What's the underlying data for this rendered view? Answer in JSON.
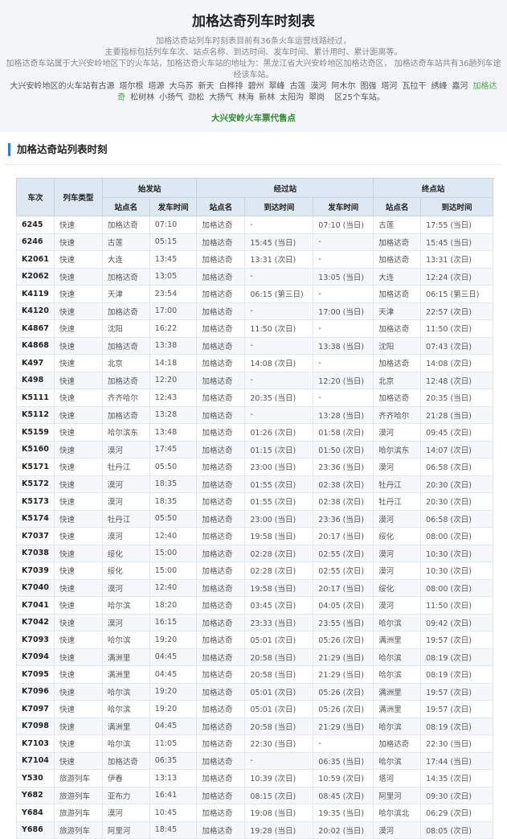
{
  "page": {
    "title": "加格达奇列车时刻表",
    "intro": [
      "加格达奇站列车时刻表目前有36条火车运营线路经过，",
      "主要指标包括列车车次、站点名称、到达时间、发车时间、累计用时、累计距离等。",
      "加格达奇车站属于大兴安岭地区下的火车站，加格达奇火车站的地址为：黑龙江省大兴安岭地区加格达奇区， 加格达奇车站共有36趟列车途经该车站。",
      "大兴安岭地区的火车站有"
    ],
    "cities": [
      "古源",
      "塔尔根",
      "塔源",
      "大乌苏",
      "新天",
      "白桦排",
      "碧州",
      "翠峰",
      "古莲",
      "漠河",
      "阿木尔",
      "图强",
      "塔河",
      "瓦拉干",
      "绣峰",
      "嘉河",
      "加格达奇",
      "松树林",
      "小扬气",
      "劲松",
      "大扬气",
      "林海",
      "新林",
      "太阳沟",
      "翠岗"
    ],
    "highlight_city": "加格达奇",
    "cities_suffix": "区25个车站。",
    "ticket_link": "大兴安岭火车票代售点",
    "section_title": "加格达奇站列表时刻"
  },
  "table": {
    "header_top": [
      "车次",
      "列车类型",
      "始发站",
      "经过站",
      "终点站"
    ],
    "header_sub": [
      "站点名",
      "发车时间",
      "站点名",
      "到达时间",
      "发车时间",
      "站点名",
      "到达时间"
    ],
    "rows": [
      [
        "6245",
        "快速",
        "加格达奇",
        "07:10",
        "加格达奇",
        "-",
        "07:10 (当日)",
        "古莲",
        "17:55 (当日)"
      ],
      [
        "6246",
        "快速",
        "古莲",
        "05:15",
        "加格达奇",
        "15:45 (当日)",
        "-",
        "加格达奇",
        "15:45 (当日)"
      ],
      [
        "K2061",
        "快速",
        "大连",
        "13:45",
        "加格达奇",
        "13:31 (次日)",
        "-",
        "加格达奇",
        "13:31 (次日)"
      ],
      [
        "K2062",
        "快速",
        "加格达奇",
        "13:05",
        "加格达奇",
        "-",
        "13:05 (当日)",
        "大连",
        "12:24 (次日)"
      ],
      [
        "K4119",
        "快速",
        "天津",
        "23:54",
        "加格达奇",
        "06:15 (第三日)",
        "-",
        "加格达奇",
        "06:15 (第三日)"
      ],
      [
        "K4120",
        "快速",
        "加格达奇",
        "17:00",
        "加格达奇",
        "-",
        "17:00 (当日)",
        "天津",
        "22:57 (次日)"
      ],
      [
        "K4867",
        "快速",
        "沈阳",
        "16:22",
        "加格达奇",
        "11:50 (次日)",
        "-",
        "加格达奇",
        "11:50 (次日)"
      ],
      [
        "K4868",
        "快速",
        "加格达奇",
        "13:38",
        "加格达奇",
        "-",
        "13:38 (当日)",
        "沈阳",
        "07:43 (次日)"
      ],
      [
        "K497",
        "快速",
        "北京",
        "14:18",
        "加格达奇",
        "14:08 (次日)",
        "-",
        "加格达奇",
        "14:08 (次日)"
      ],
      [
        "K498",
        "快速",
        "加格达奇",
        "12:20",
        "加格达奇",
        "-",
        "12:20 (当日)",
        "北京",
        "12:48 (次日)"
      ],
      [
        "K5111",
        "快速",
        "齐齐哈尔",
        "12:43",
        "加格达奇",
        "20:35 (当日)",
        "-",
        "加格达奇",
        "20:35 (当日)"
      ],
      [
        "K5112",
        "快速",
        "加格达奇",
        "13:28",
        "加格达奇",
        "-",
        "13:28 (当日)",
        "齐齐哈尔",
        "21:28 (当日)"
      ],
      [
        "K5159",
        "快速",
        "哈尔滨东",
        "13:48",
        "加格达奇",
        "01:26 (次日)",
        "01:58 (次日)",
        "漠河",
        "09:45 (次日)"
      ],
      [
        "K5160",
        "快速",
        "漠河",
        "17:45",
        "加格达奇",
        "01:15 (次日)",
        "01:50 (次日)",
        "哈尔滨东",
        "14:07 (次日)"
      ],
      [
        "K5171",
        "快速",
        "牡丹江",
        "05:50",
        "加格达奇",
        "23:00 (当日)",
        "23:36 (当日)",
        "漠河",
        "06:58 (次日)"
      ],
      [
        "K5172",
        "快速",
        "漠河",
        "18:35",
        "加格达奇",
        "01:55 (次日)",
        "02:38 (次日)",
        "牡丹江",
        "20:30 (次日)"
      ],
      [
        "K5173",
        "快速",
        "漠河",
        "18:35",
        "加格达奇",
        "01:55 (次日)",
        "02:38 (次日)",
        "牡丹江",
        "20:30 (次日)"
      ],
      [
        "K5174",
        "快速",
        "牡丹江",
        "05:50",
        "加格达奇",
        "23:00 (当日)",
        "23:36 (当日)",
        "漠河",
        "06:58 (次日)"
      ],
      [
        "K7037",
        "快速",
        "漠河",
        "12:40",
        "加格达奇",
        "19:58 (当日)",
        "20:17 (当日)",
        "绥化",
        "08:00 (次日)"
      ],
      [
        "K7038",
        "快速",
        "绥化",
        "15:00",
        "加格达奇",
        "02:28 (次日)",
        "02:55 (次日)",
        "漠河",
        "10:30 (次日)"
      ],
      [
        "K7039",
        "快速",
        "绥化",
        "15:00",
        "加格达奇",
        "02:28 (次日)",
        "02:55 (次日)",
        "漠河",
        "10:30 (次日)"
      ],
      [
        "K7040",
        "快速",
        "漠河",
        "12:40",
        "加格达奇",
        "19:58 (当日)",
        "20:17 (当日)",
        "绥化",
        "08:00 (次日)"
      ],
      [
        "K7041",
        "快速",
        "哈尔滨",
        "18:20",
        "加格达奇",
        "03:45 (次日)",
        "04:05 (次日)",
        "漠河",
        "11:50 (次日)"
      ],
      [
        "K7042",
        "快速",
        "漠河",
        "16:15",
        "加格达奇",
        "23:33 (当日)",
        "23:55 (当日)",
        "哈尔滨",
        "09:42 (次日)"
      ],
      [
        "K7093",
        "快速",
        "哈尔滨",
        "19:20",
        "加格达奇",
        "05:01 (次日)",
        "05:26 (次日)",
        "满洲里",
        "19:57 (次日)"
      ],
      [
        "K7094",
        "快速",
        "满洲里",
        "04:45",
        "加格达奇",
        "20:58 (当日)",
        "21:29 (当日)",
        "哈尔滨",
        "08:19 (次日)"
      ],
      [
        "K7095",
        "快速",
        "满洲里",
        "04:45",
        "加格达奇",
        "20:58 (当日)",
        "21:29 (当日)",
        "哈尔滨",
        "08:19 (次日)"
      ],
      [
        "K7096",
        "快速",
        "哈尔滨",
        "19:20",
        "加格达奇",
        "05:01 (次日)",
        "05:26 (次日)",
        "满洲里",
        "19:57 (次日)"
      ],
      [
        "K7097",
        "快速",
        "哈尔滨",
        "19:20",
        "加格达奇",
        "05:01 (次日)",
        "05:26 (次日)",
        "满洲里",
        "19:57 (次日)"
      ],
      [
        "K7098",
        "快速",
        "满洲里",
        "04:45",
        "加格达奇",
        "20:58 (当日)",
        "21:29 (当日)",
        "哈尔滨",
        "08:19 (次日)"
      ],
      [
        "K7103",
        "快速",
        "哈尔滨",
        "11:05",
        "加格达奇",
        "22:30 (当日)",
        "-",
        "加格达奇",
        "22:30 (当日)"
      ],
      [
        "K7104",
        "快速",
        "加格达奇",
        "06:35",
        "加格达奇",
        "-",
        "06:35 (当日)",
        "哈尔滨",
        "17:44 (当日)"
      ],
      [
        "Y530",
        "旅游列车",
        "伊春",
        "13:13",
        "加格达奇",
        "10:39 (次日)",
        "10:59 (次日)",
        "塔河",
        "14:35 (次日)"
      ],
      [
        "Y682",
        "旅游列车",
        "亚布力",
        "16:41",
        "加格达奇",
        "08:15 (次日)",
        "08:45 (次日)",
        "阿里河",
        "09:30 (次日)"
      ],
      [
        "Y684",
        "旅游列车",
        "漠河",
        "10:45",
        "加格达奇",
        "19:08 (当日)",
        "19:35 (当日)",
        "哈尔滨北",
        "06:29 (次日)"
      ],
      [
        "Y686",
        "旅游列车",
        "阿里河",
        "18:45",
        "加格达奇",
        "19:28 (当日)",
        "20:02 (当日)",
        "漠河",
        "08:05 (次日)"
      ]
    ]
  },
  "colors": {
    "accent": "#2a7fd4",
    "header_bg": "#dde8f3",
    "link_green": "#2e8b2e",
    "city_highlight": "#4aa844"
  }
}
